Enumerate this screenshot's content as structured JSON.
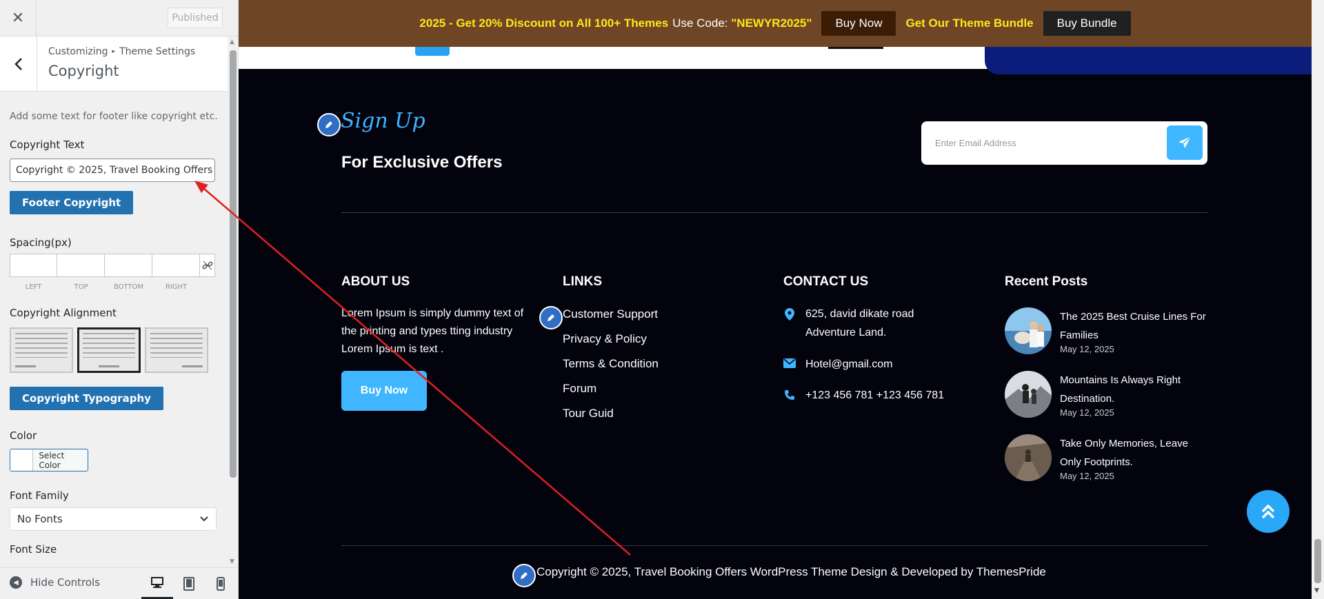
{
  "sidebar": {
    "close_icon": "close-icon",
    "publish_label": "Published",
    "breadcrumb": [
      "Customizing",
      "Theme Settings"
    ],
    "section_title": "Copyright",
    "description": "Add some text for footer like copyright etc.",
    "copyright_text_label": "Copyright Text",
    "copyright_text_value": "Copyright © 2025, Travel Booking Offers",
    "footer_copyright_button": "Footer Copyright",
    "spacing_label": "Spacing(px)",
    "spacing_fields": [
      "LEFT",
      "TOP",
      "BOTTOM",
      "RIGHT"
    ],
    "alignment_label": "Copyright Alignment",
    "alignment_options": [
      "left",
      "center",
      "right"
    ],
    "alignment_selected": "center",
    "typography_button": "Copyright Typography",
    "color_label": "Color",
    "select_color": "Select Color",
    "font_family_label": "Font Family",
    "font_family_value": "No Fonts",
    "font_size_label": "Font Size",
    "hide_controls": "Hide Controls",
    "devices": [
      "desktop",
      "tablet",
      "mobile"
    ],
    "active_device": "desktop"
  },
  "promo": {
    "text1": "2025 - Get 20% Discount on All 100+ Themes",
    "text2": "Use Code:",
    "code": "\"NEWYR2025\"",
    "buy_now": "Buy Now",
    "bundle_text": "Get Our Theme Bundle",
    "buy_bundle": "Buy Bundle"
  },
  "footer": {
    "signup_title": "Sign Up",
    "signup_subtitle": "For Exclusive Offers",
    "email_placeholder": "Enter Email Address",
    "about": {
      "heading": "ABOUT US",
      "text": "Lorem Ipsum is simply dummy text of the printing and types tting industry Lorem Ipsum is text .",
      "button": "Buy Now"
    },
    "links": {
      "heading": "LINKS",
      "items": [
        "Customer Support",
        "Privacy & Policy",
        "Terms & Condition",
        "Forum",
        "Tour Guid"
      ]
    },
    "contact": {
      "heading": "CONTACT US",
      "address": "625, david dikate road Adventure Land.",
      "email": "Hotel@gmail.com",
      "phone": "+123 456 781 +123 456 781"
    },
    "recent": {
      "heading": "Recent Posts",
      "posts": [
        {
          "title": "The 2025 Best Cruise Lines For Families",
          "date": "May 12, 2025"
        },
        {
          "title": "Mountains Is Always Right Destination.",
          "date": "May 12, 2025"
        },
        {
          "title": "Take Only Memories, Leave Only Footprints.",
          "date": "May 12, 2025"
        }
      ]
    },
    "copyright": "Copyright © 2025, Travel Booking Offers WordPress Theme Design & Developed by ThemesPride"
  },
  "colors": {
    "promo_bg": "#6e4626",
    "footer_bg": "#03030e",
    "accent_blue": "#3fb6ff",
    "wp_blue": "#2271b1",
    "annotation_red": "#e02020"
  }
}
